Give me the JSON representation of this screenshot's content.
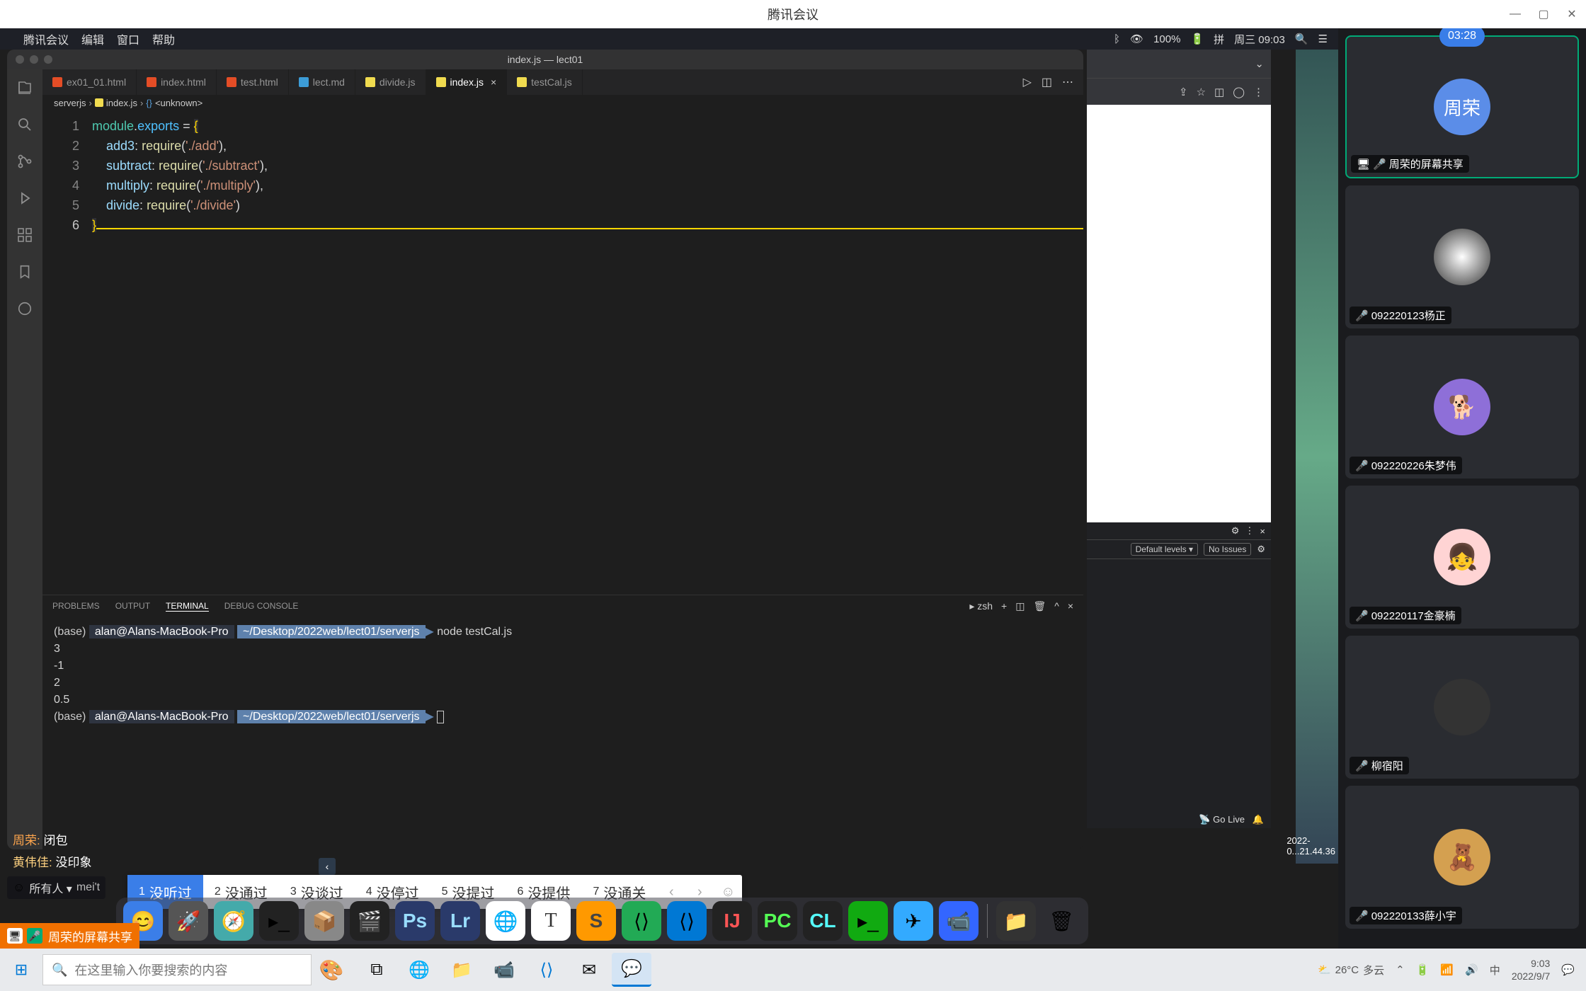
{
  "window": {
    "app_title": "腾讯会议"
  },
  "mac_menubar": {
    "app": "腾讯会议",
    "menu_edit": "编辑",
    "menu_window": "窗口",
    "menu_help": "帮助",
    "battery": "100%",
    "date_time": "周三 09:03"
  },
  "vscode": {
    "title": "index.js — lect01",
    "tabs": [
      {
        "name": "ex01_01.html",
        "type": "html"
      },
      {
        "name": "index.html",
        "type": "html"
      },
      {
        "name": "test.html",
        "type": "html"
      },
      {
        "name": "lect.md",
        "type": "md"
      },
      {
        "name": "divide.js",
        "type": "js"
      },
      {
        "name": "index.js",
        "type": "js",
        "active": true
      },
      {
        "name": "testCal.js",
        "type": "js"
      }
    ],
    "breadcrumb": {
      "folder": "serverjs",
      "file": "index.js",
      "symbol": "<unknown>"
    },
    "code": {
      "l1_module": "module",
      "l1_exports": "exports",
      "l2_key": "add3",
      "l2_req": "require",
      "l2_str": "'./add'",
      "l3_key": "subtract",
      "l3_req": "require",
      "l3_str": "'./subtract'",
      "l4_key": "multiply",
      "l4_req": "require",
      "l4_str": "'./multiply'",
      "l5_key": "divide",
      "l5_req": "require",
      "l5_str": "'./divide'"
    },
    "panel": {
      "tab_problems": "PROBLEMS",
      "tab_output": "OUTPUT",
      "tab_terminal": "TERMINAL",
      "tab_debug": "DEBUG CONSOLE",
      "shell": "zsh"
    },
    "terminal": {
      "base": "(base)",
      "user": "alan@Alans-MacBook-Pro",
      "path": "~/Desktop/2022web/lect01/serverjs",
      "cmd": "node testCal.js",
      "out1": "3",
      "out2": "-1",
      "out3": "2",
      "out4": "0.5"
    },
    "statusbar": {
      "golive": "Go Live"
    }
  },
  "chat": {
    "msg1_name": "周荣:",
    "msg1_text": "闭包",
    "msg2_name": "黄伟佳:",
    "msg2_text": "没印象",
    "to_label": "所有人 ▾",
    "input_text": "mei't"
  },
  "ime": {
    "candidates": [
      {
        "n": "1",
        "t": "没听过"
      },
      {
        "n": "2",
        "t": "没通过"
      },
      {
        "n": "3",
        "t": "没谈过"
      },
      {
        "n": "4",
        "t": "没停过"
      },
      {
        "n": "5",
        "t": "没提过"
      },
      {
        "n": "6",
        "t": "没提供"
      },
      {
        "n": "7",
        "t": "没通关"
      }
    ]
  },
  "browser": {
    "default_levels": "Default levels ▾",
    "no_issues": "No Issues"
  },
  "desktop_time": "2022-0...21.44.36",
  "participants": {
    "timer": "03:28",
    "self_avatar_text": "周荣",
    "list": [
      {
        "name": "周荣的屏幕共享",
        "self": true
      },
      {
        "name": "092220123杨正"
      },
      {
        "name": "092220226朱梦伟"
      },
      {
        "name": "092220117金豪楠"
      },
      {
        "name": "柳宿阳"
      },
      {
        "name": "092220133薛小宇"
      }
    ]
  },
  "share_bar": {
    "text": "周荣的屏幕共享"
  },
  "taskbar": {
    "search_placeholder": "在这里输入你要搜索的内容",
    "weather_temp": "26°C",
    "weather_desc": "多云",
    "ime_lang": "中",
    "time": "9:03",
    "date": "2022/9/7"
  }
}
